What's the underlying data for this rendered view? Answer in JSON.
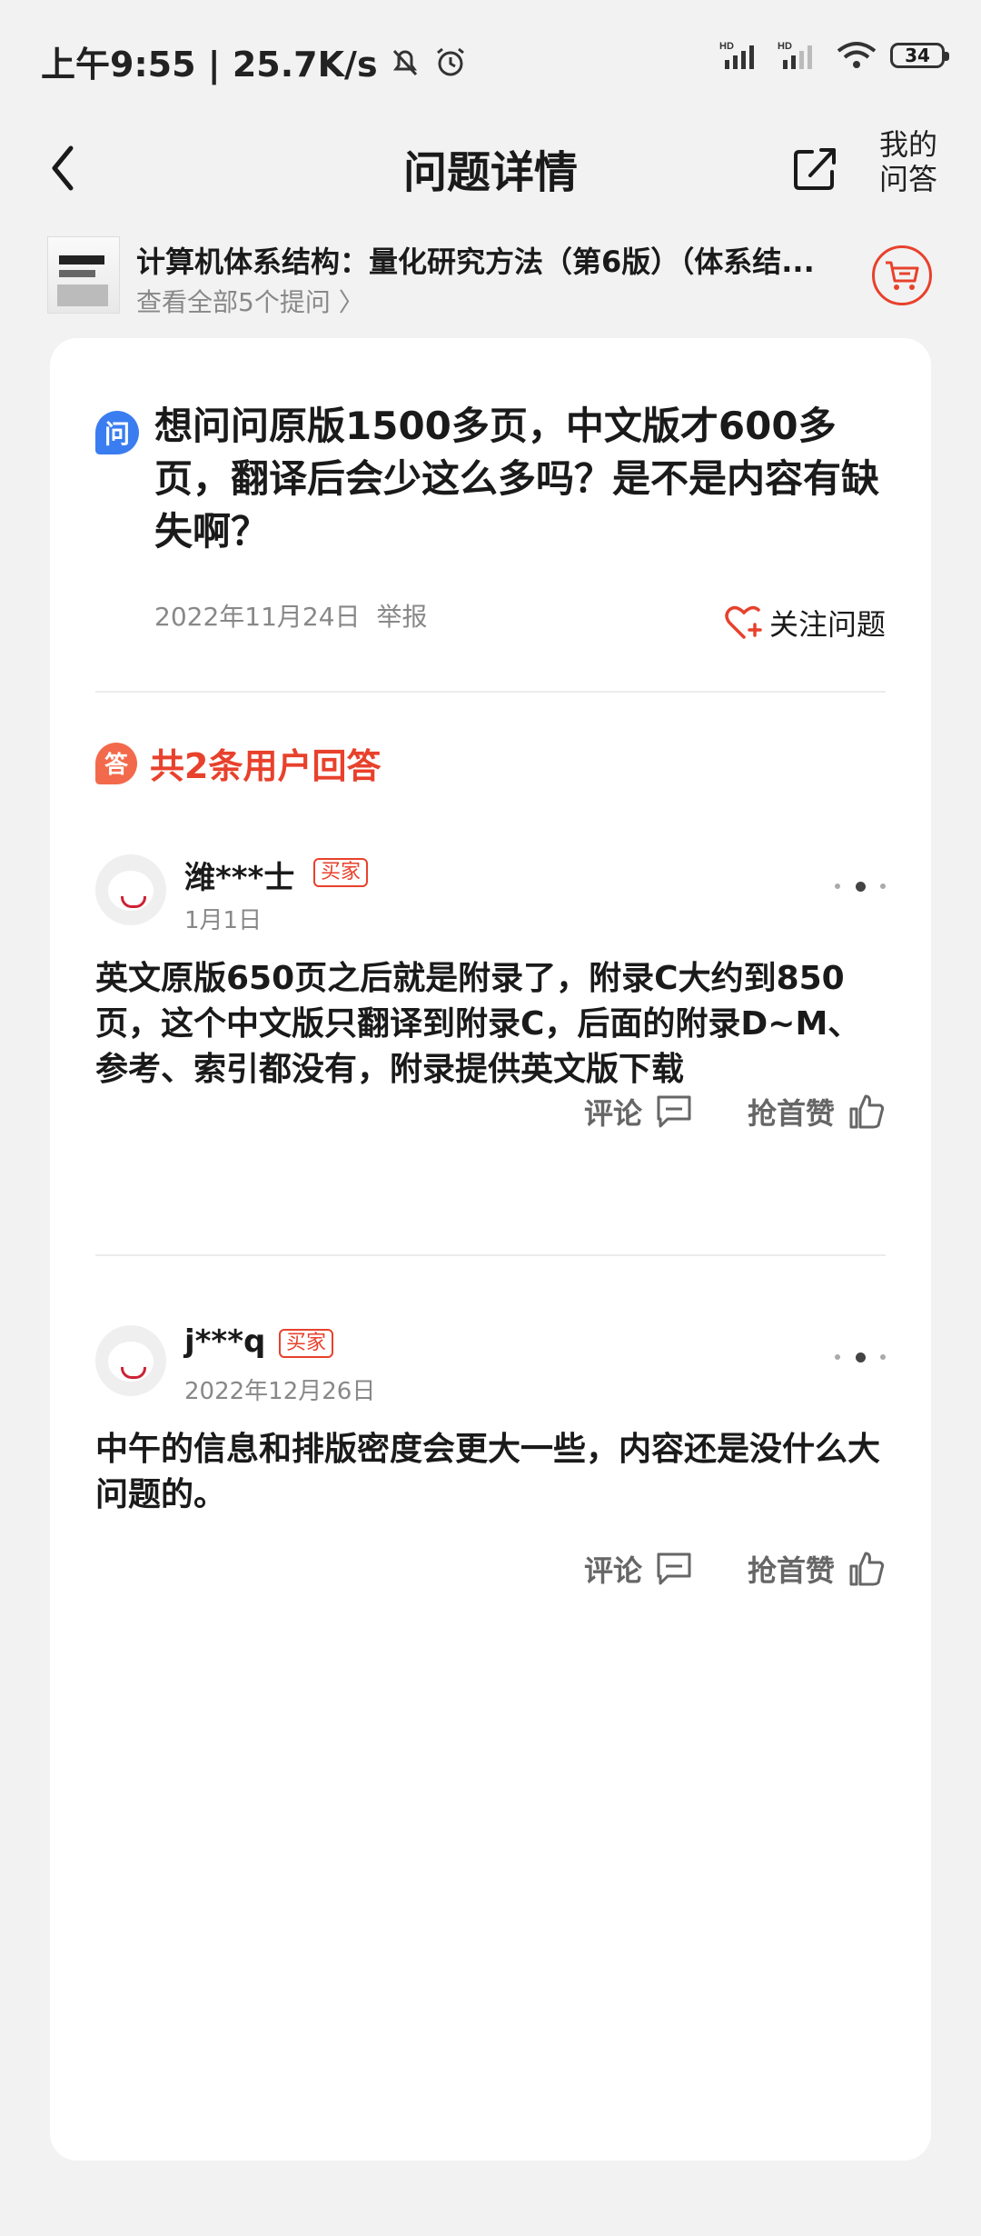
{
  "status_bar": {
    "time_speed": "上午9:55 | 25.7K/s",
    "signal1_label": "HD",
    "signal2_label": "HD",
    "battery": "34"
  },
  "header": {
    "title": "问题详情",
    "my_qa_line1": "我的",
    "my_qa_line2": "问答"
  },
  "product": {
    "title": "计算机体系结构：量化研究方法（第6版）（体系结...",
    "sub": "查看全部5个提问 〉"
  },
  "question": {
    "icon_text": "问",
    "text": "想问问原版1500多页，中文版才600多页，翻译后会少这么多吗？是不是内容有缺失啊？",
    "date": "2022年11月24日",
    "report": "举报",
    "follow": "关注问题"
  },
  "answers_heading": {
    "icon_text": "答",
    "count": "共2条用户回答"
  },
  "answers": [
    {
      "username": "潍***士",
      "tag": "买家",
      "date": "1月1日",
      "text": "英文原版650页之后就是附录了，附录C大约到850页，这个中文版只翻译到附录C，后面的附录D~M、参考、索引都没有，附录提供英文版下载",
      "comment": "评论",
      "like": "抢首赞"
    },
    {
      "username": "j***q",
      "tag": "买家",
      "date": "2022年12月26日",
      "text": "中午的信息和排版密度会更大一些，内容还是没什么大问题的。",
      "comment": "评论",
      "like": "抢首赞"
    }
  ],
  "colors": {
    "accent_red": "#e8412c",
    "question_blue": "#3a7df0",
    "answer_orange": "#f26a4b",
    "background": "#f2f2f2"
  },
  "icons": {
    "back": "chevron-left-icon",
    "share": "share-icon",
    "cart": "cart-icon",
    "follow": "heart-plus-icon",
    "comment": "comment-icon",
    "like": "thumb-up-icon",
    "more": "more-dots-icon"
  }
}
